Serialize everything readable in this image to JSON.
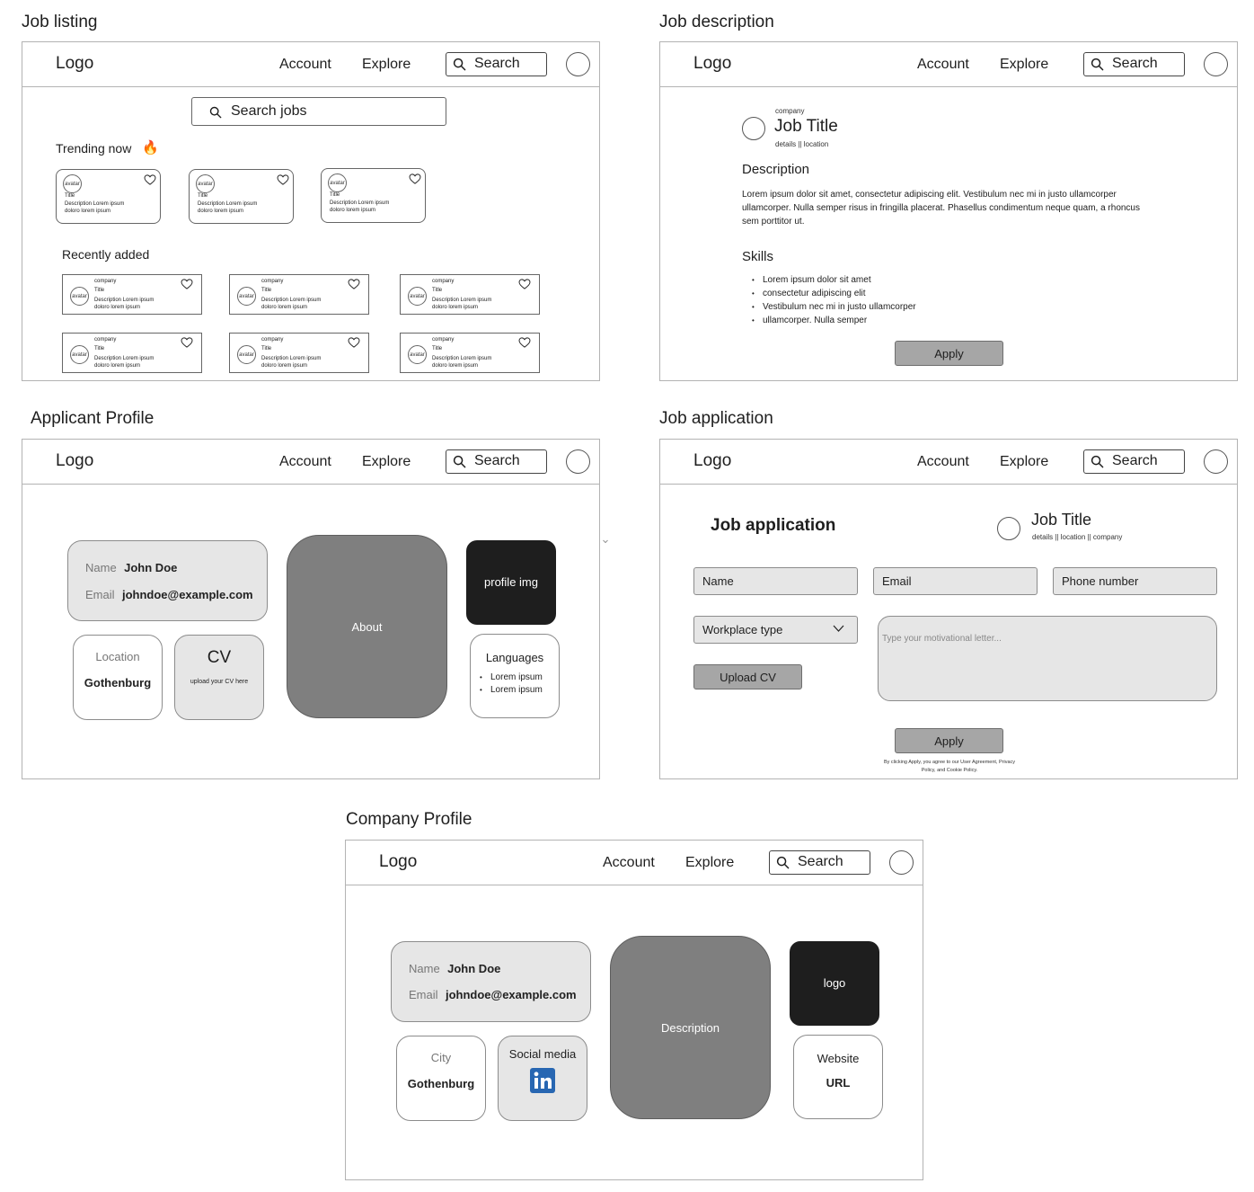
{
  "nav": {
    "logo": "Logo",
    "account": "Account",
    "explore": "Explore",
    "search": "Search"
  },
  "titles": {
    "job_listing": "Job listing",
    "job_description": "Job description",
    "applicant_profile": "Applicant Profile",
    "job_application": "Job application",
    "company_profile": "Company Profile"
  },
  "listing": {
    "search_jobs": "Search jobs",
    "trending": "Trending now",
    "trending_emoji": "🔥",
    "recently_added": "Recently added",
    "avatar": "avatar",
    "company": "company",
    "title": "Title",
    "desc1": "Description Lorem ipsum",
    "desc2": "doloro lorem ipsum"
  },
  "description": {
    "company": "company",
    "job_title": "Job Title",
    "details": "details || location",
    "desc_heading": "Description",
    "desc_text": "Lorem ipsum dolor sit amet, consectetur adipiscing elit. Vestibulum nec mi in justo ullamcorper ullamcorper. Nulla semper risus in fringilla placerat. Phasellus condimentum neque quam, a rhoncus sem porttitor ut.",
    "skills_heading": "Skills",
    "skills": [
      "Lorem ipsum dolor sit amet",
      "consectetur adipiscing elit",
      "Vestibulum nec mi in justo ullamcorper",
      "ullamcorper. Nulla semper"
    ],
    "apply": "Apply"
  },
  "applicant": {
    "name_label": "Name",
    "name_value": "John Doe",
    "email_label": "Email",
    "email_value": "johndoe@example.com",
    "location_label": "Location",
    "location_value": "Gothenburg",
    "cv_title": "CV",
    "cv_sub": "upload your CV here",
    "about": "About",
    "profile_img": "profile img",
    "languages": "Languages",
    "language_items": [
      "Lorem ipsum",
      "Lorem ipsum"
    ]
  },
  "application": {
    "heading": "Job application",
    "job_title": "Job Title",
    "details": "details || location || company",
    "name": "Name",
    "email": "Email",
    "phone": "Phone number",
    "workplace": "Workplace type",
    "upload_cv": "Upload CV",
    "letter_placeholder": "Type your motivational letter...",
    "apply": "Apply",
    "legal1": "By clicking Apply, you agree to our User Agreement, Privacy",
    "legal2": "Policy, and Cookie Policy."
  },
  "company": {
    "name_label": "Name",
    "name_value": "John Doe",
    "email_label": "Email",
    "email_value": "johndoe@example.com",
    "city_label": "City",
    "city_value": "Gothenburg",
    "social": "Social media",
    "description": "Description",
    "logo": "logo",
    "website": "Website",
    "url": "URL"
  },
  "colors": {
    "linkedin": "#2867b2",
    "dark_block": "#7f7f7f",
    "black_block": "#1e1e1e",
    "field_bg": "#e6e6e6"
  },
  "icons": [
    "search-icon",
    "heart-icon",
    "fire-emoji",
    "chevron-down-icon",
    "linkedin-icon",
    "avatar-circle"
  ]
}
